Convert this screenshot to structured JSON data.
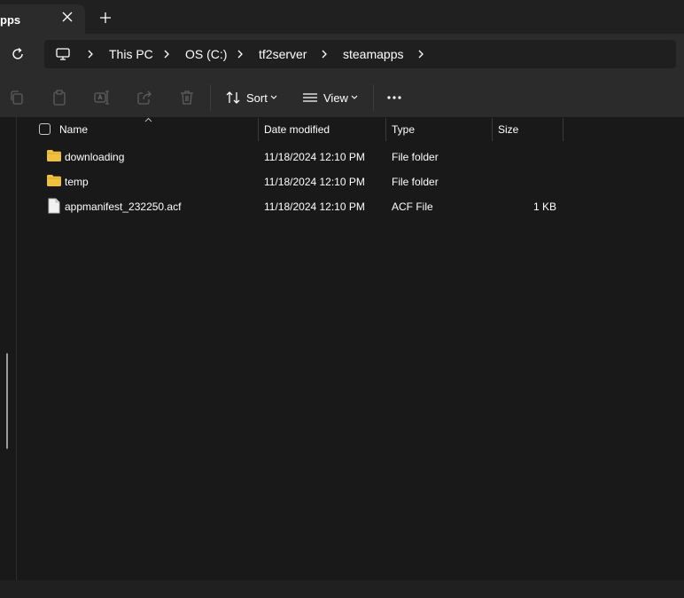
{
  "tab": {
    "title": "pps"
  },
  "breadcrumb": [
    "This PC",
    "OS (C:)",
    "tf2server",
    "steamapps"
  ],
  "toolbar": {
    "sort_label": "Sort",
    "view_label": "View"
  },
  "columns": [
    "Name",
    "Date modified",
    "Type",
    "Size"
  ],
  "files": [
    {
      "name": "downloading",
      "date": "11/18/2024 12:10 PM",
      "type": "File folder",
      "size": "",
      "icon": "folder-icon"
    },
    {
      "name": "temp",
      "date": "11/18/2024 12:10 PM",
      "type": "File folder",
      "size": "",
      "icon": "folder-icon"
    },
    {
      "name": "appmanifest_232250.acf",
      "date": "11/18/2024 12:10 PM",
      "type": "ACF File",
      "size": "1 KB",
      "icon": "file-icon"
    }
  ],
  "colors": {
    "background": "#191919",
    "chrome": "#2b2b2b",
    "folder": "#f0c040",
    "text": "#ffffff"
  }
}
